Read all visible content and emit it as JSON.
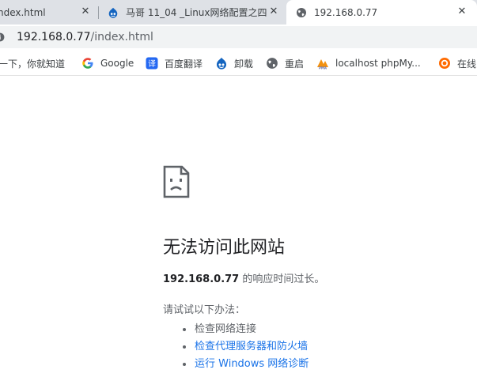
{
  "tabs": [
    {
      "title": "ndex.html",
      "close": "✕"
    },
    {
      "title": "马哥 11_04 _Linux网络配置之四",
      "close": "✕"
    },
    {
      "title": "192.168.0.77",
      "close": "✕"
    }
  ],
  "address_bar": {
    "host": "192.168.0.77",
    "path": "/index.html"
  },
  "bookmarks": [
    {
      "label": "一下，你就知道",
      "icon": "baidu-icon"
    },
    {
      "label": "Google",
      "icon": "google-icon"
    },
    {
      "label": "百度翻译",
      "icon": "translate-icon"
    },
    {
      "label": "卸载",
      "icon": "drupal-icon"
    },
    {
      "label": "重启",
      "icon": "globe-icon"
    },
    {
      "label": "localhost phpMy...",
      "icon": "phpmyadmin-icon"
    },
    {
      "label": "在线",
      "icon": "swirl-icon"
    }
  ],
  "error": {
    "heading": "无法访问此网站",
    "host": "192.168.0.77",
    "summary_suffix": " 的响应时间过长。",
    "try_label": "请试试以下办法：",
    "suggestions": [
      {
        "text": "检查网络连接",
        "link": false
      },
      {
        "text": "检查代理服务器和防火墙",
        "link": true
      },
      {
        "text": "运行 Windows 网络诊断",
        "link": true
      }
    ]
  },
  "colors": {
    "tabstrip": "#dee1e6",
    "omnibox": "#f1f3f4",
    "link": "#1a73e8",
    "text_secondary": "#5f6368"
  }
}
